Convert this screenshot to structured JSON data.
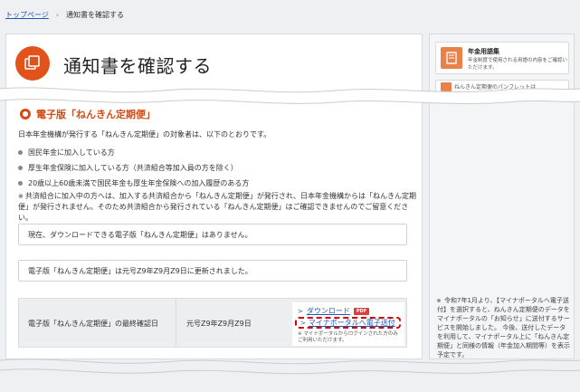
{
  "breadcrumb": {
    "home": "トップページ",
    "separator": "›",
    "current": "通知書を確認する"
  },
  "page": {
    "title": "通知書を確認する",
    "title_icon": "documents-icon",
    "accent_color": "#e2531b"
  },
  "sidebar": {
    "card": {
      "title": "年金用語集",
      "desc": "年金制度で使用される用語の内容をご確認いただけます。",
      "icon": "book-icon"
    },
    "peek": {
      "text": "ねんきん定期便のパンフレットは"
    },
    "note": "令和7年1月より、【マイナポータルへ電子送付】を選択すると、ねんきん定期便のデータをマイナポータルの「お知らせ」に送付するサービスを開始しました。 今後、送付したデータを利用して、マイナポータル上に「ねんきん定期便」と同様の情報（年金加入期間等）を表示予定です。"
  },
  "section": {
    "title": "電子版「ねんきん定期便」",
    "intro": "日本年金機構が発行する「ねんきん定期便」の対象者は、以下のとおりです。",
    "bullets": [
      "国民年金に加入している方",
      "厚生年金保険に加入している方（共済組合等加入員の方を除く）",
      "20歳以上60歳未満で国民年金も厚生年金保険への加入履歴のある方"
    ],
    "note_mark": "※",
    "note": "共済組合に加入中の方へは、加入する共済組合から「ねんきん定期便」が発行され、日本年金機構からは「ねんきん定期便」が発行されません。そのため共済組合から発行されている「ねんきん定期便」はご確認できませんのでご留意ください。",
    "box1": "現在、ダウンロードできる電子版「ねんきん定期便」はありません。",
    "box2": "電子版「ねんきん定期便」は元号Z9年Z9月Z9日に更新されました。"
  },
  "confirm": {
    "label": "電子版「ねんきん定期便」の最終確認日",
    "date": "元号Z9年Z9月Z9日",
    "download_label": "ダウンロード",
    "pdf_badge": "PDF",
    "mynaportal_label": "マイナポータルへ電子送付",
    "small_note": "※ マイナポータルからログインされた方のみご利用いただけます。",
    "highlight_color": "#d40000"
  }
}
